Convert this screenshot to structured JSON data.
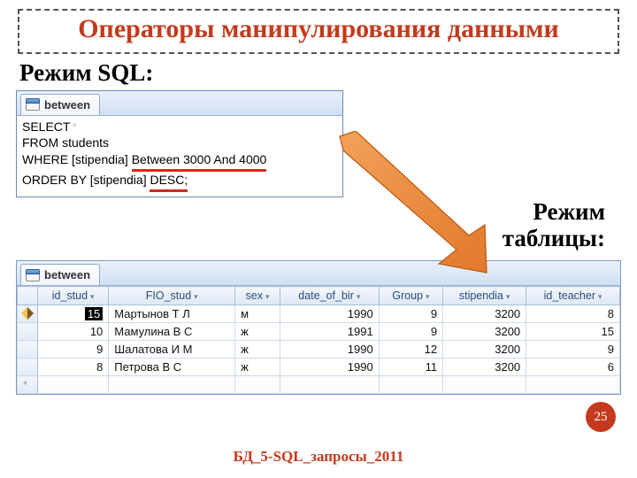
{
  "title": "Операторы манипулирования данными",
  "sql_mode_label": "Режим SQL:",
  "table_mode_label": "Режим\nтаблицы:",
  "tab_label": "between",
  "sql": {
    "line1_a": "SELECT",
    "line1_b": "*",
    "line2": "FROM students",
    "line3_a": "WHERE [stipendia]",
    "line3_b": "Between 3000 And 4000",
    "line4_a": "ORDER BY [stipendia]",
    "line4_b": "DESC;"
  },
  "columns": [
    "id_stud",
    "FIO_stud",
    "sex",
    "date_of_bir",
    "Group",
    "stipendia",
    "id_teacher"
  ],
  "rows": [
    {
      "id_stud": "15",
      "fio": "Мартынов Т Л",
      "sex": "м",
      "dob": "1990",
      "group": "9",
      "stip": "3200",
      "teacher": "8",
      "editing": true,
      "hl": true
    },
    {
      "id_stud": "10",
      "fio": "Мамулина В С",
      "sex": "ж",
      "dob": "1991",
      "group": "9",
      "stip": "3200",
      "teacher": "15"
    },
    {
      "id_stud": "9",
      "fio": "Шалатова И М",
      "sex": "ж",
      "dob": "1990",
      "group": "12",
      "stip": "3200",
      "teacher": "9"
    },
    {
      "id_stud": "8",
      "fio": "Петрова В С",
      "sex": "ж",
      "dob": "1990",
      "group": "11",
      "stip": "3200",
      "teacher": "6"
    }
  ],
  "page_number": "25",
  "footer": "БД_5-SQL_запросы_2011"
}
